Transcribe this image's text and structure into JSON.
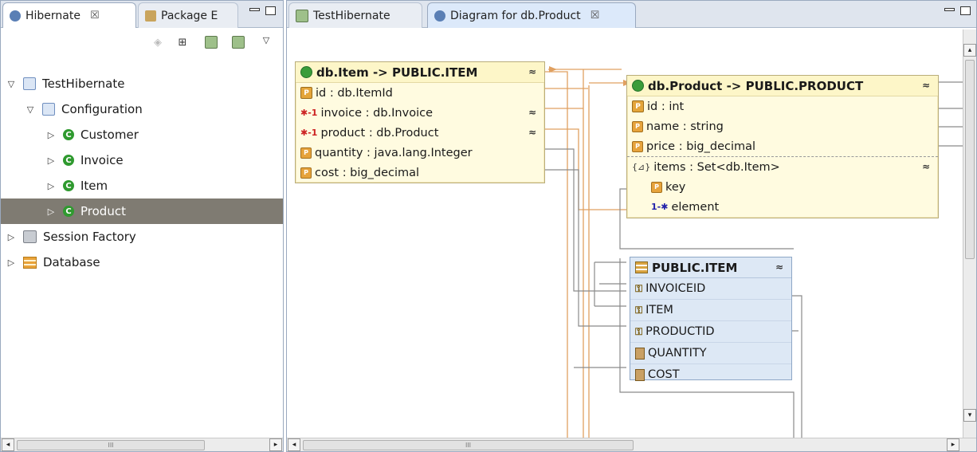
{
  "left_view": {
    "tabs": [
      {
        "label": "Hibernate",
        "active": true,
        "close": "☒"
      },
      {
        "label": "Package E",
        "active": false
      }
    ],
    "tree": {
      "project": "TestHibernate",
      "configuration": "Configuration",
      "classes": [
        "Customer",
        "Invoice",
        "Item",
        "Product"
      ],
      "selected": "Product",
      "session_factory": "Session Factory",
      "database": "Database"
    },
    "hscroll_grip": "III"
  },
  "right_view": {
    "tabs": [
      {
        "label": "TestHibernate",
        "active": false
      },
      {
        "label": "Diagram for db.Product",
        "active": true,
        "close": "☒"
      }
    ],
    "hscroll_grip": "III",
    "entity_item": {
      "title": "db.Item -> PUBLIC.ITEM",
      "rows": [
        "id : db.ItemId",
        "invoice : db.Invoice",
        "product : db.Product",
        "quantity : java.lang.Integer",
        "cost : big_decimal"
      ]
    },
    "entity_product": {
      "title": "db.Product -> PUBLIC.PRODUCT",
      "rows": [
        "id : int",
        "name : string",
        "price : big_decimal",
        "items : Set<db.Item>",
        "key",
        "element"
      ]
    },
    "table_item": {
      "title": "PUBLIC.ITEM",
      "columns": [
        "INVOICEID",
        "ITEM",
        "PRODUCTID",
        "QUANTITY",
        "COST"
      ]
    }
  },
  "colors": {
    "tab_bar": "#dfe5ee",
    "entity_fill": "#fffbe0",
    "table_fill": "#dde8f5",
    "connector_orange": "#e0a060",
    "connector_gray": "#8a8a8a",
    "selection": "#7f7b72"
  }
}
